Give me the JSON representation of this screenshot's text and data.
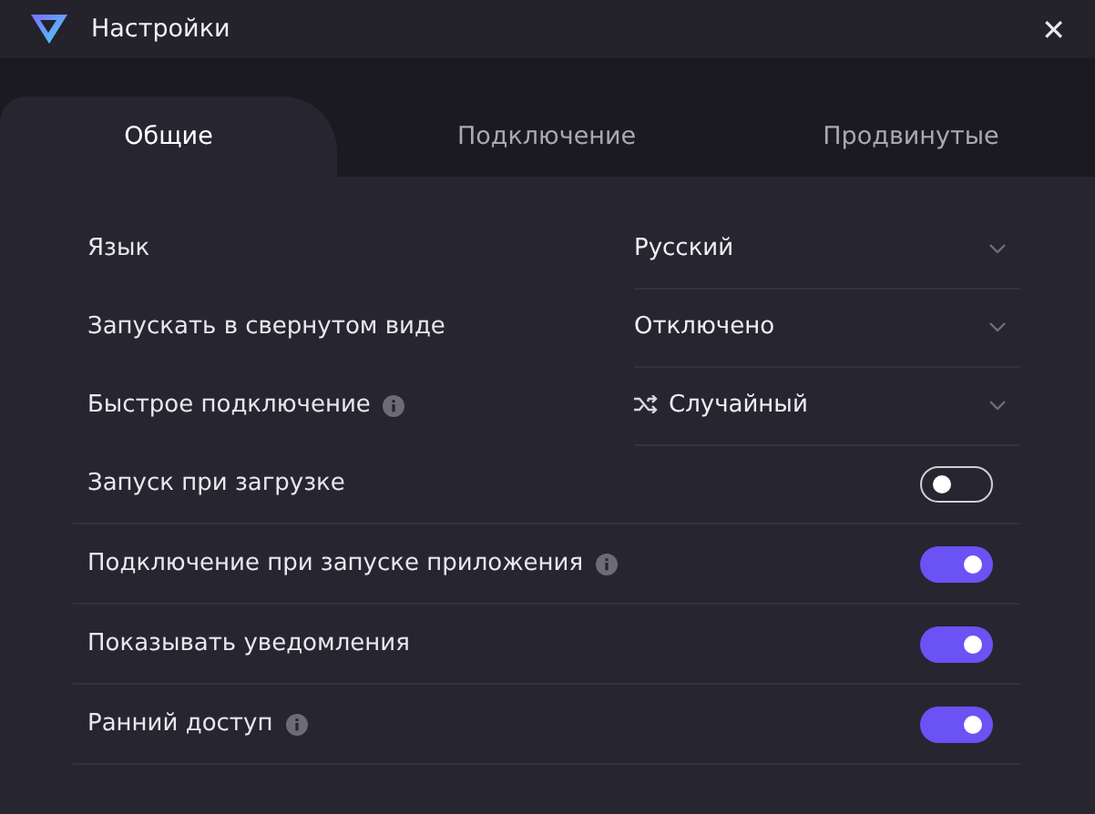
{
  "window": {
    "title": "Настройки",
    "close": "✕"
  },
  "tabs": [
    {
      "label": "Общие",
      "selected": true
    },
    {
      "label": "Подключение",
      "selected": false
    },
    {
      "label": "Продвинутые",
      "selected": false
    }
  ],
  "settings": [
    {
      "kind": "dropdown",
      "label": "Язык",
      "info": false,
      "value": "Русский",
      "shuffle": false
    },
    {
      "kind": "dropdown",
      "label": "Запускать в свернутом виде",
      "info": false,
      "value": "Отключено",
      "shuffle": false
    },
    {
      "kind": "dropdown",
      "label": "Быстрое подключение",
      "info": true,
      "value": "Случайный",
      "shuffle": true
    },
    {
      "kind": "toggle",
      "label": "Запуск при загрузке",
      "info": false,
      "on": false
    },
    {
      "kind": "toggle",
      "label": "Подключение при запуске приложения",
      "info": true,
      "on": true
    },
    {
      "kind": "toggle",
      "label": "Показывать уведомления",
      "info": false,
      "on": true
    },
    {
      "kind": "toggle",
      "label": "Ранний доступ",
      "info": true,
      "on": true
    }
  ]
}
